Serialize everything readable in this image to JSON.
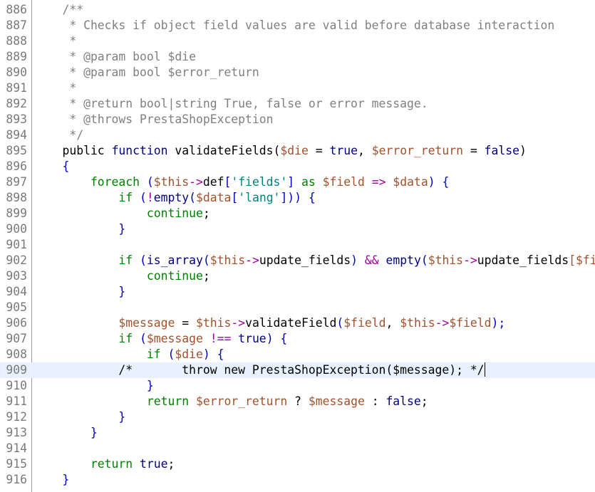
{
  "editor": {
    "lines": [
      {
        "num": "886",
        "segs": [
          {
            "t": "    /**",
            "c": "comment"
          }
        ]
      },
      {
        "num": "887",
        "segs": [
          {
            "t": "     * Checks if object field values are valid before database interaction",
            "c": "comment"
          }
        ]
      },
      {
        "num": "888",
        "segs": [
          {
            "t": "     *",
            "c": "comment"
          }
        ]
      },
      {
        "num": "889",
        "segs": [
          {
            "t": "     * @param bool $die",
            "c": "comment"
          }
        ]
      },
      {
        "num": "890",
        "segs": [
          {
            "t": "     * @param bool $error_return",
            "c": "comment"
          }
        ]
      },
      {
        "num": "891",
        "segs": [
          {
            "t": "     *",
            "c": "comment"
          }
        ]
      },
      {
        "num": "892",
        "segs": [
          {
            "t": "     * @return bool|string True, false or error message.",
            "c": "comment"
          }
        ]
      },
      {
        "num": "893",
        "segs": [
          {
            "t": "     * @throws PrestaShopException",
            "c": "comment"
          }
        ]
      },
      {
        "num": "894",
        "segs": [
          {
            "t": "     */",
            "c": "comment"
          }
        ]
      },
      {
        "num": "895",
        "segs": [
          {
            "t": "    public ",
            "c": "plain"
          },
          {
            "t": "function ",
            "c": "keyword"
          },
          {
            "t": "validateFields(",
            "c": "plain"
          },
          {
            "t": "$die",
            "c": "var2"
          },
          {
            "t": " = ",
            "c": "plain"
          },
          {
            "t": "true",
            "c": "keyword"
          },
          {
            "t": ", ",
            "c": "plain"
          },
          {
            "t": "$error_return",
            "c": "var2"
          },
          {
            "t": " = ",
            "c": "plain"
          },
          {
            "t": "false",
            "c": "keyword"
          },
          {
            "t": ")",
            "c": "plain"
          }
        ]
      },
      {
        "num": "896",
        "segs": [
          {
            "t": "    {",
            "c": "brace"
          }
        ]
      },
      {
        "num": "897",
        "segs": [
          {
            "t": "        foreach ",
            "c": "kw2"
          },
          {
            "t": "(",
            "c": "brace"
          },
          {
            "t": "$this",
            "c": "var2"
          },
          {
            "t": "->",
            "c": "op"
          },
          {
            "t": "def",
            "c": "plain"
          },
          {
            "t": "[",
            "c": "brace"
          },
          {
            "t": "'fields'",
            "c": "str"
          },
          {
            "t": "] ",
            "c": "brace"
          },
          {
            "t": "as ",
            "c": "kw2"
          },
          {
            "t": "$field",
            "c": "var2"
          },
          {
            "t": " => ",
            "c": "op"
          },
          {
            "t": "$data",
            "c": "var2"
          },
          {
            "t": ") {",
            "c": "brace"
          }
        ]
      },
      {
        "num": "898",
        "segs": [
          {
            "t": "            if ",
            "c": "kw2"
          },
          {
            "t": "(",
            "c": "brace"
          },
          {
            "t": "!",
            "c": "op"
          },
          {
            "t": "empty",
            "c": "keyword"
          },
          {
            "t": "(",
            "c": "brace"
          },
          {
            "t": "$data",
            "c": "var2"
          },
          {
            "t": "[",
            "c": "brace"
          },
          {
            "t": "'lang'",
            "c": "str"
          },
          {
            "t": "])) {",
            "c": "brace"
          }
        ]
      },
      {
        "num": "899",
        "segs": [
          {
            "t": "                continue",
            "c": "kw2"
          },
          {
            "t": ";",
            "c": "plain"
          }
        ]
      },
      {
        "num": "900",
        "segs": [
          {
            "t": "            }",
            "c": "brace"
          }
        ]
      },
      {
        "num": "901",
        "segs": [
          {
            "t": "",
            "c": "plain"
          }
        ]
      },
      {
        "num": "902",
        "segs": [
          {
            "t": "            if ",
            "c": "kw2"
          },
          {
            "t": "(",
            "c": "brace"
          },
          {
            "t": "is_array",
            "c": "keyword"
          },
          {
            "t": "(",
            "c": "brace"
          },
          {
            "t": "$this",
            "c": "var2"
          },
          {
            "t": "->",
            "c": "op"
          },
          {
            "t": "update_fields",
            "c": "plain"
          },
          {
            "t": ") ",
            "c": "brace"
          },
          {
            "t": "&& ",
            "c": "op"
          },
          {
            "t": "empty",
            "c": "keyword"
          },
          {
            "t": "(",
            "c": "brace"
          },
          {
            "t": "$this",
            "c": "var2"
          },
          {
            "t": "->",
            "c": "op"
          },
          {
            "t": "update_fields",
            "c": "plain"
          },
          {
            "t": "[$field",
            "c": "var2"
          }
        ]
      },
      {
        "num": "903",
        "segs": [
          {
            "t": "                continue",
            "c": "kw2"
          },
          {
            "t": ";",
            "c": "plain"
          }
        ]
      },
      {
        "num": "904",
        "segs": [
          {
            "t": "            }",
            "c": "brace"
          }
        ]
      },
      {
        "num": "905",
        "segs": [
          {
            "t": "",
            "c": "plain"
          }
        ]
      },
      {
        "num": "906",
        "segs": [
          {
            "t": "            $message",
            "c": "var2"
          },
          {
            "t": " = ",
            "c": "plain"
          },
          {
            "t": "$this",
            "c": "var2"
          },
          {
            "t": "->",
            "c": "op"
          },
          {
            "t": "validateField",
            "c": "plain"
          },
          {
            "t": "(",
            "c": "brace"
          },
          {
            "t": "$field",
            "c": "var2"
          },
          {
            "t": ", ",
            "c": "plain"
          },
          {
            "t": "$this",
            "c": "var2"
          },
          {
            "t": "->",
            "c": "op"
          },
          {
            "t": "$field",
            "c": "var2"
          },
          {
            "t": ");",
            "c": "brace"
          }
        ]
      },
      {
        "num": "907",
        "segs": [
          {
            "t": "            if ",
            "c": "kw2"
          },
          {
            "t": "(",
            "c": "brace"
          },
          {
            "t": "$message",
            "c": "var2"
          },
          {
            "t": " !== ",
            "c": "op"
          },
          {
            "t": "true",
            "c": "keyword"
          },
          {
            "t": ") {",
            "c": "brace"
          }
        ]
      },
      {
        "num": "908",
        "segs": [
          {
            "t": "                if ",
            "c": "kw2"
          },
          {
            "t": "(",
            "c": "brace"
          },
          {
            "t": "$die",
            "c": "var2"
          },
          {
            "t": ") {",
            "c": "brace"
          }
        ]
      },
      {
        "num": "909",
        "current": true,
        "segs": [
          {
            "t": "            /*       throw new PrestaShopException($message); */",
            "c": "plain"
          },
          {
            "t": "",
            "c": "caret"
          }
        ]
      },
      {
        "num": "910",
        "segs": [
          {
            "t": "                }",
            "c": "brace"
          }
        ]
      },
      {
        "num": "911",
        "segs": [
          {
            "t": "                return ",
            "c": "kw2"
          },
          {
            "t": "$error_return",
            "c": "var2"
          },
          {
            "t": " ? ",
            "c": "plain"
          },
          {
            "t": "$message",
            "c": "var2"
          },
          {
            "t": " : ",
            "c": "plain"
          },
          {
            "t": "false",
            "c": "keyword"
          },
          {
            "t": ";",
            "c": "plain"
          }
        ]
      },
      {
        "num": "912",
        "segs": [
          {
            "t": "            }",
            "c": "brace"
          }
        ]
      },
      {
        "num": "913",
        "segs": [
          {
            "t": "        }",
            "c": "brace"
          }
        ]
      },
      {
        "num": "914",
        "segs": [
          {
            "t": "",
            "c": "plain"
          }
        ]
      },
      {
        "num": "915",
        "segs": [
          {
            "t": "        return ",
            "c": "kw2"
          },
          {
            "t": "true",
            "c": "keyword"
          },
          {
            "t": ";",
            "c": "plain"
          }
        ]
      },
      {
        "num": "916",
        "segs": [
          {
            "t": "    }",
            "c": "brace"
          }
        ]
      }
    ]
  },
  "theme": {
    "comment": "#808080",
    "keyword": "#000080",
    "control": "#008000",
    "variable": "#a0522d",
    "string": "#008080",
    "operator": "#a000a0",
    "brace": "#0000c0",
    "current_line_bg": "#e8f2fe",
    "gutter_text": "#7a7a7a"
  }
}
